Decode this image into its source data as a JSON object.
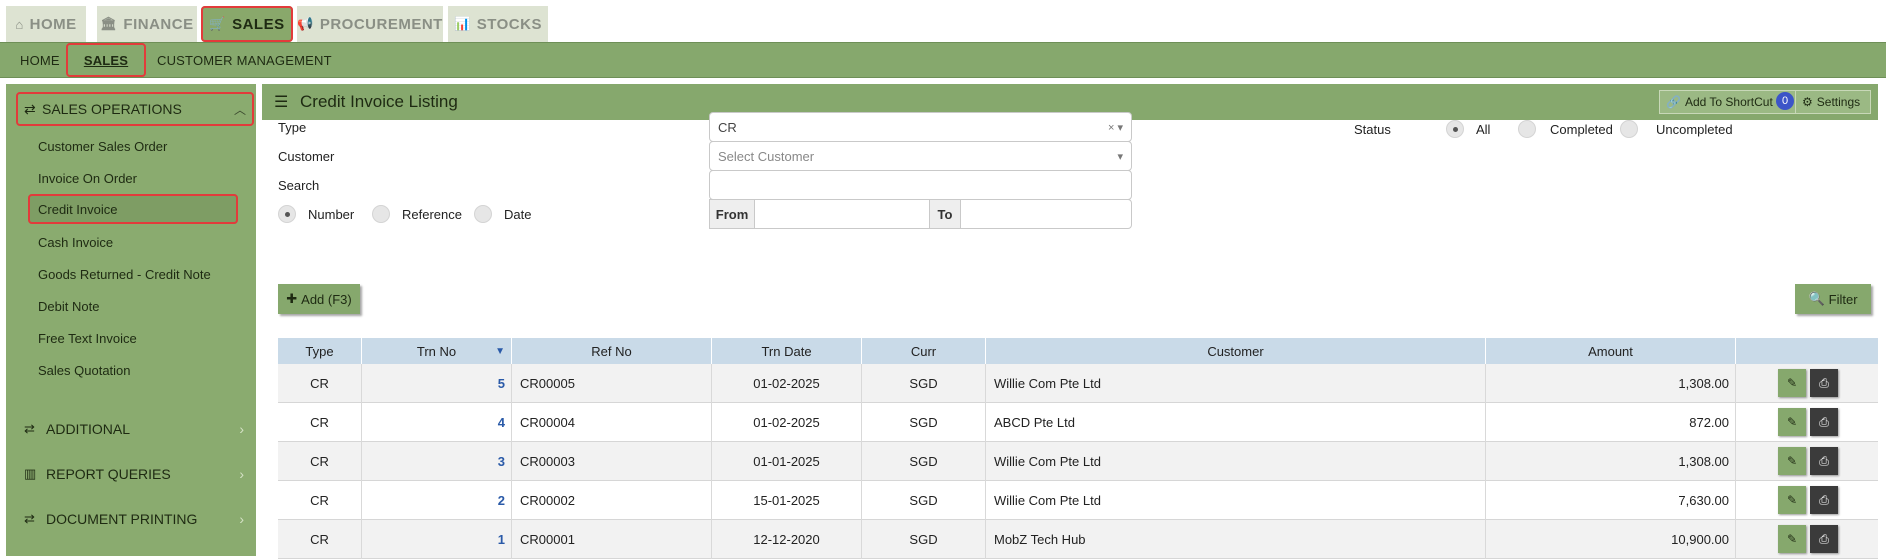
{
  "top_tabs": [
    {
      "icon": "⌂",
      "label": "HOME"
    },
    {
      "icon": "🏛",
      "label": "FINANCE"
    },
    {
      "icon": "🛒",
      "label": "SALES"
    },
    {
      "icon": "📢",
      "label": "PROCUREMENT"
    },
    {
      "icon": "📊",
      "label": "STOCKS"
    }
  ],
  "subnav": [
    "HOME",
    "SALES",
    "CUSTOMER MANAGEMENT"
  ],
  "sidebar": {
    "header": "SALES OPERATIONS",
    "items": [
      "Customer Sales Order",
      "Invoice On Order",
      "Credit Invoice",
      "Cash Invoice",
      "Goods Returned - Credit Note",
      "Debit Note",
      "Free Text Invoice",
      "Sales Quotation"
    ],
    "sections": [
      "ADDITIONAL",
      "REPORT QUERIES",
      "DOCUMENT PRINTING"
    ]
  },
  "panel": {
    "title": "Credit Invoice Listing",
    "shortcut_label": "Add To ShortCut",
    "shortcut_count": "0",
    "settings_label": "Settings"
  },
  "filters": {
    "type_label": "Type",
    "type_value": "CR",
    "customer_label": "Customer",
    "customer_placeholder": "Select Customer",
    "search_label": "Search",
    "search_by": [
      "Number",
      "Reference",
      "Date"
    ],
    "from_label": "From",
    "to_label": "To",
    "status_label": "Status",
    "status_options": [
      "All",
      "Completed",
      "Uncompleted"
    ]
  },
  "buttons": {
    "add": "Add (F3)",
    "filter": "Filter"
  },
  "table": {
    "headers": [
      "Type",
      "Trn No",
      "Ref No",
      "Trn Date",
      "Curr",
      "Customer",
      "Amount"
    ],
    "rows": [
      {
        "type": "CR",
        "trn_no": "5",
        "ref_no": "CR00005",
        "date": "01-02-2025",
        "curr": "SGD",
        "customer": "Willie Com Pte Ltd",
        "amount": "1,308.00"
      },
      {
        "type": "CR",
        "trn_no": "4",
        "ref_no": "CR00004",
        "date": "01-02-2025",
        "curr": "SGD",
        "customer": "ABCD Pte Ltd",
        "amount": "872.00"
      },
      {
        "type": "CR",
        "trn_no": "3",
        "ref_no": "CR00003",
        "date": "01-01-2025",
        "curr": "SGD",
        "customer": "Willie Com Pte Ltd",
        "amount": "1,308.00"
      },
      {
        "type": "CR",
        "trn_no": "2",
        "ref_no": "CR00002",
        "date": "15-01-2025",
        "curr": "SGD",
        "customer": "Willie Com Pte Ltd",
        "amount": "7,630.00"
      },
      {
        "type": "CR",
        "trn_no": "1",
        "ref_no": "CR00001",
        "date": "12-12-2020",
        "curr": "SGD",
        "customer": "MobZ Tech Hub",
        "amount": "10,900.00"
      }
    ]
  }
}
